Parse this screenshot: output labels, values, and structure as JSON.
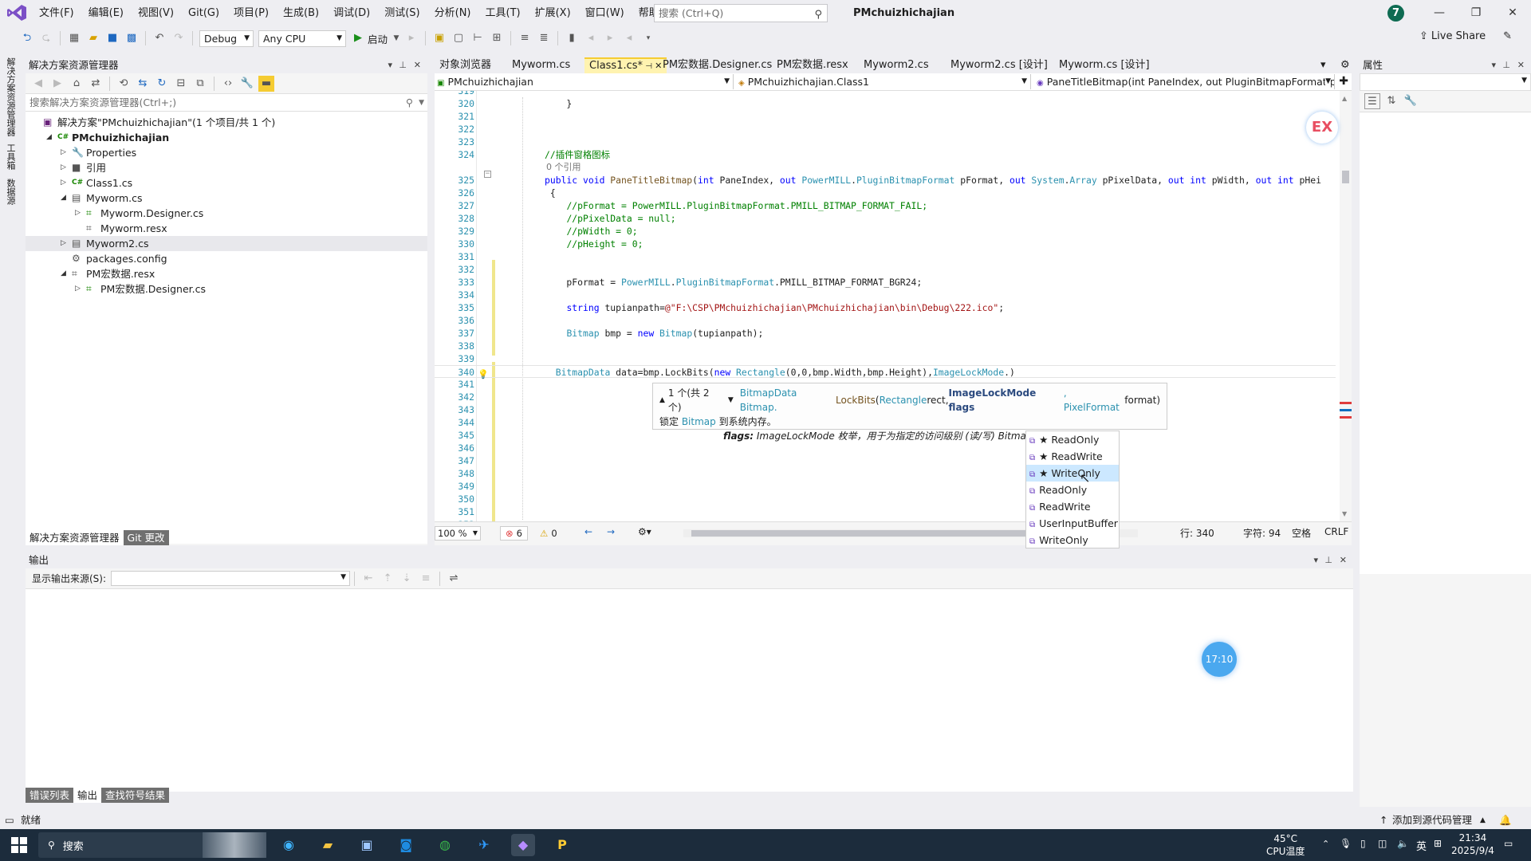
{
  "menu": [
    "文件(F)",
    "编辑(E)",
    "视图(V)",
    "Git(G)",
    "项目(P)",
    "生成(B)",
    "调试(D)",
    "测试(S)",
    "分析(N)",
    "工具(T)",
    "扩展(X)",
    "窗口(W)",
    "帮助(H)"
  ],
  "search": {
    "placeholder": "搜索 (Ctrl+Q)"
  },
  "solution_name": "PMchuizhichajian",
  "avatar_letter": "7",
  "toolbar": {
    "config": "Debug",
    "platform": "Any CPU",
    "start": "启动",
    "live_share": "Live Share"
  },
  "left_strip": [
    "解决方案资源管理器",
    "工具箱",
    "数据源"
  ],
  "solution_explorer": {
    "title": "解决方案资源管理器",
    "search_placeholder": "搜索解决方案资源管理器(Ctrl+;)",
    "tree": [
      {
        "label": "解决方案\"PMchuizhichajian\"(1 个项目/共 1 个)",
        "indent": 0,
        "exp": "",
        "icon": "solution-icon",
        "glyph": "▣",
        "color": "#68217a"
      },
      {
        "label": "PMchuizhichajian",
        "indent": 1,
        "exp": "◢",
        "icon": "csproj-icon",
        "glyph": "C#",
        "color": "#178600",
        "bold": true
      },
      {
        "label": "Properties",
        "indent": 2,
        "exp": "▷",
        "icon": "wrench-icon",
        "glyph": "🔧",
        "color": "#555"
      },
      {
        "label": "引用",
        "indent": 2,
        "exp": "▷",
        "icon": "references-icon",
        "glyph": "■",
        "color": "#555"
      },
      {
        "label": "Class1.cs",
        "indent": 2,
        "exp": "▷",
        "icon": "csharp-file-icon",
        "glyph": "C#",
        "color": "#178600"
      },
      {
        "label": "Myworm.cs",
        "indent": 2,
        "exp": "◢",
        "icon": "form-icon",
        "glyph": "▤",
        "color": "#555"
      },
      {
        "label": "Myworm.Designer.cs",
        "indent": 3,
        "exp": "▷",
        "icon": "designer-file-icon",
        "glyph": "⌗",
        "color": "#178600"
      },
      {
        "label": "Myworm.resx",
        "indent": 3,
        "exp": "",
        "icon": "resx-icon",
        "glyph": "⌗",
        "color": "#555"
      },
      {
        "label": "Myworm2.cs",
        "indent": 2,
        "exp": "▷",
        "icon": "form-icon",
        "glyph": "▤",
        "color": "#555",
        "selected": true
      },
      {
        "label": "packages.config",
        "indent": 2,
        "exp": "",
        "icon": "config-icon",
        "glyph": "⚙",
        "color": "#555"
      },
      {
        "label": "PM宏数据.resx",
        "indent": 2,
        "exp": "◢",
        "icon": "resx-icon",
        "glyph": "⌗",
        "color": "#555"
      },
      {
        "label": "PM宏数据.Designer.cs",
        "indent": 3,
        "exp": "▷",
        "icon": "designer-file-icon",
        "glyph": "⌗",
        "color": "#178600"
      }
    ],
    "bottom_tabs": [
      "解决方案资源管理器",
      "Git 更改"
    ]
  },
  "doc_tabs": [
    {
      "label": "对象浏览器",
      "active": false
    },
    {
      "label": "Myworm.cs",
      "active": false
    },
    {
      "label": "Class1.cs*",
      "active": true
    },
    {
      "label": "PM宏数据.Designer.cs",
      "active": false
    },
    {
      "label": "PM宏数据.resx",
      "active": false
    },
    {
      "label": "Myworm2.cs",
      "active": false
    },
    {
      "label": "Myworm2.cs [设计]",
      "active": false
    },
    {
      "label": "Myworm.cs [设计]",
      "active": false
    }
  ],
  "navbar": {
    "project": "PMchuizhichajian",
    "class": "PMchuizhichajian.Class1",
    "member": "PaneTitleBitmap(int PaneIndex, out PluginBitmapFormat pF"
  },
  "code_lines": [
    {
      "n": "319",
      "t": ""
    },
    {
      "n": "320",
      "html": "<span style='padding-left:0'>    }</span>"
    },
    {
      "n": "321",
      "t": ""
    },
    {
      "n": "322",
      "t": ""
    },
    {
      "n": "323",
      "t": ""
    },
    {
      "n": "324",
      "html": "<span class='cm'>//插件窗格图标</span>"
    },
    {
      "ref": "0 个引用"
    },
    {
      "n": "325",
      "html": "<span class='kw'>public void</span> <span class='mth'>PaneTitleBitmap</span>(<span class='kw'>int</span> PaneIndex, <span class='kw'>out</span> <span class='ty'>PowerMILL</span>.<span class='ty'>PluginBitmapFormat</span> pFormat, <span class='kw'>out</span> <span class='ty'>System</span>.<span class='ty'>Array</span> pPixelData, <span class='kw'>out int</span> pWidth, <span class='kw'>out int</span> pHei"
    },
    {
      "n": "326",
      "html": " {"
    },
    {
      "n": "327",
      "html": "    <span class='cm'>//pFormat = PowerMILL.PluginBitmapFormat.PMILL_BITMAP_FORMAT_FAIL;</span>"
    },
    {
      "n": "328",
      "html": "    <span class='cm'>//pPixelData = null;</span>"
    },
    {
      "n": "329",
      "html": "    <span class='cm'>//pWidth = 0;</span>"
    },
    {
      "n": "330",
      "html": "    <span class='cm'>//pHeight = 0;</span>"
    },
    {
      "n": "331",
      "t": ""
    },
    {
      "n": "332",
      "t": ""
    },
    {
      "n": "333",
      "html": "    pFormat = <span class='ty'>PowerMILL</span>.<span class='ty'>PluginBitmapFormat</span>.PMILL_BITMAP_FORMAT_BGR24;"
    },
    {
      "n": "334",
      "t": ""
    },
    {
      "n": "335",
      "html": "    <span class='kw'>string</span> tupianpath=<span class='st'>@\"F:\\CSP\\PMchuizhichajian\\PMchuizhichajian\\bin\\Debug\\222.ico\"</span>;"
    },
    {
      "n": "336",
      "t": ""
    },
    {
      "n": "337",
      "html": "    <span class='ty'>Bitmap</span> bmp = <span class='kw'>new</span> <span class='ty'>Bitmap</span>(tupianpath);"
    },
    {
      "n": "338",
      "t": ""
    },
    {
      "n": "339",
      "t": ""
    },
    {
      "n": "340",
      "html": "  <span class='ty'>BitmapData</span> data=bmp.LockBits(<span class='kw'>new</span> <span class='ty'>Rectangle</span>(0,0,bmp.Width,bmp.Height),<span class='ty'>ImageLockMode</span>.)"
    },
    {
      "n": "341",
      "t": ""
    },
    {
      "n": "342",
      "t": ""
    },
    {
      "n": "343",
      "t": ""
    },
    {
      "n": "344",
      "t": ""
    },
    {
      "n": "345",
      "t": ""
    },
    {
      "n": "346",
      "t": ""
    },
    {
      "n": "347",
      "t": ""
    },
    {
      "n": "348",
      "t": ""
    },
    {
      "n": "349",
      "t": ""
    },
    {
      "n": "350",
      "t": ""
    },
    {
      "n": "351",
      "t": ""
    },
    {
      "n": "352",
      "t": ""
    }
  ],
  "sigtip": {
    "counter": "1 个(共 2 个)",
    "sig_pre": "BitmapData Bitmap.",
    "sig_method": "LockBits",
    "sig_p1t": "Rectangle",
    "sig_p1n": " rect, ",
    "sig_p2": "ImageLockMode flags",
    "sig_p3t": ", PixelFormat",
    "sig_p3n": " format)",
    "desc_pre": "锁定 ",
    "desc_type": "Bitmap",
    "desc_post": " 到系统内存。",
    "flags_label": "flags:",
    "flags_desc": " ImageLockMode 枚举，用于为指定的访问级别 (读/写) Bitmap。"
  },
  "completion": [
    {
      "label": "★ ReadOnly"
    },
    {
      "label": "★ ReadWrite"
    },
    {
      "label": "★ WriteOnly",
      "selected": true
    },
    {
      "label": "ReadOnly"
    },
    {
      "label": "ReadWrite"
    },
    {
      "label": "UserInputBuffer"
    },
    {
      "label": "WriteOnly"
    }
  ],
  "editor_status": {
    "zoom": "100 %",
    "errors": "6",
    "warnings": "0",
    "line": "行: 340",
    "char": "字符: 94",
    "space": "空格",
    "eol": "CRLF"
  },
  "ex_badge": "EX",
  "properties_title": "属性",
  "output": {
    "title": "输出",
    "source_label": "显示输出来源(S):",
    "tabs": [
      "错误列表",
      "输出",
      "查找符号结果"
    ]
  },
  "timer_bubble": "17:10",
  "status": {
    "ready": "就绪",
    "source_control": "添加到源代码管理"
  },
  "taskbar": {
    "search": "搜索",
    "temp": "45°C",
    "temp_label": "CPU温度",
    "ime": "英",
    "time": "21:34",
    "date": "2025/9/4"
  }
}
